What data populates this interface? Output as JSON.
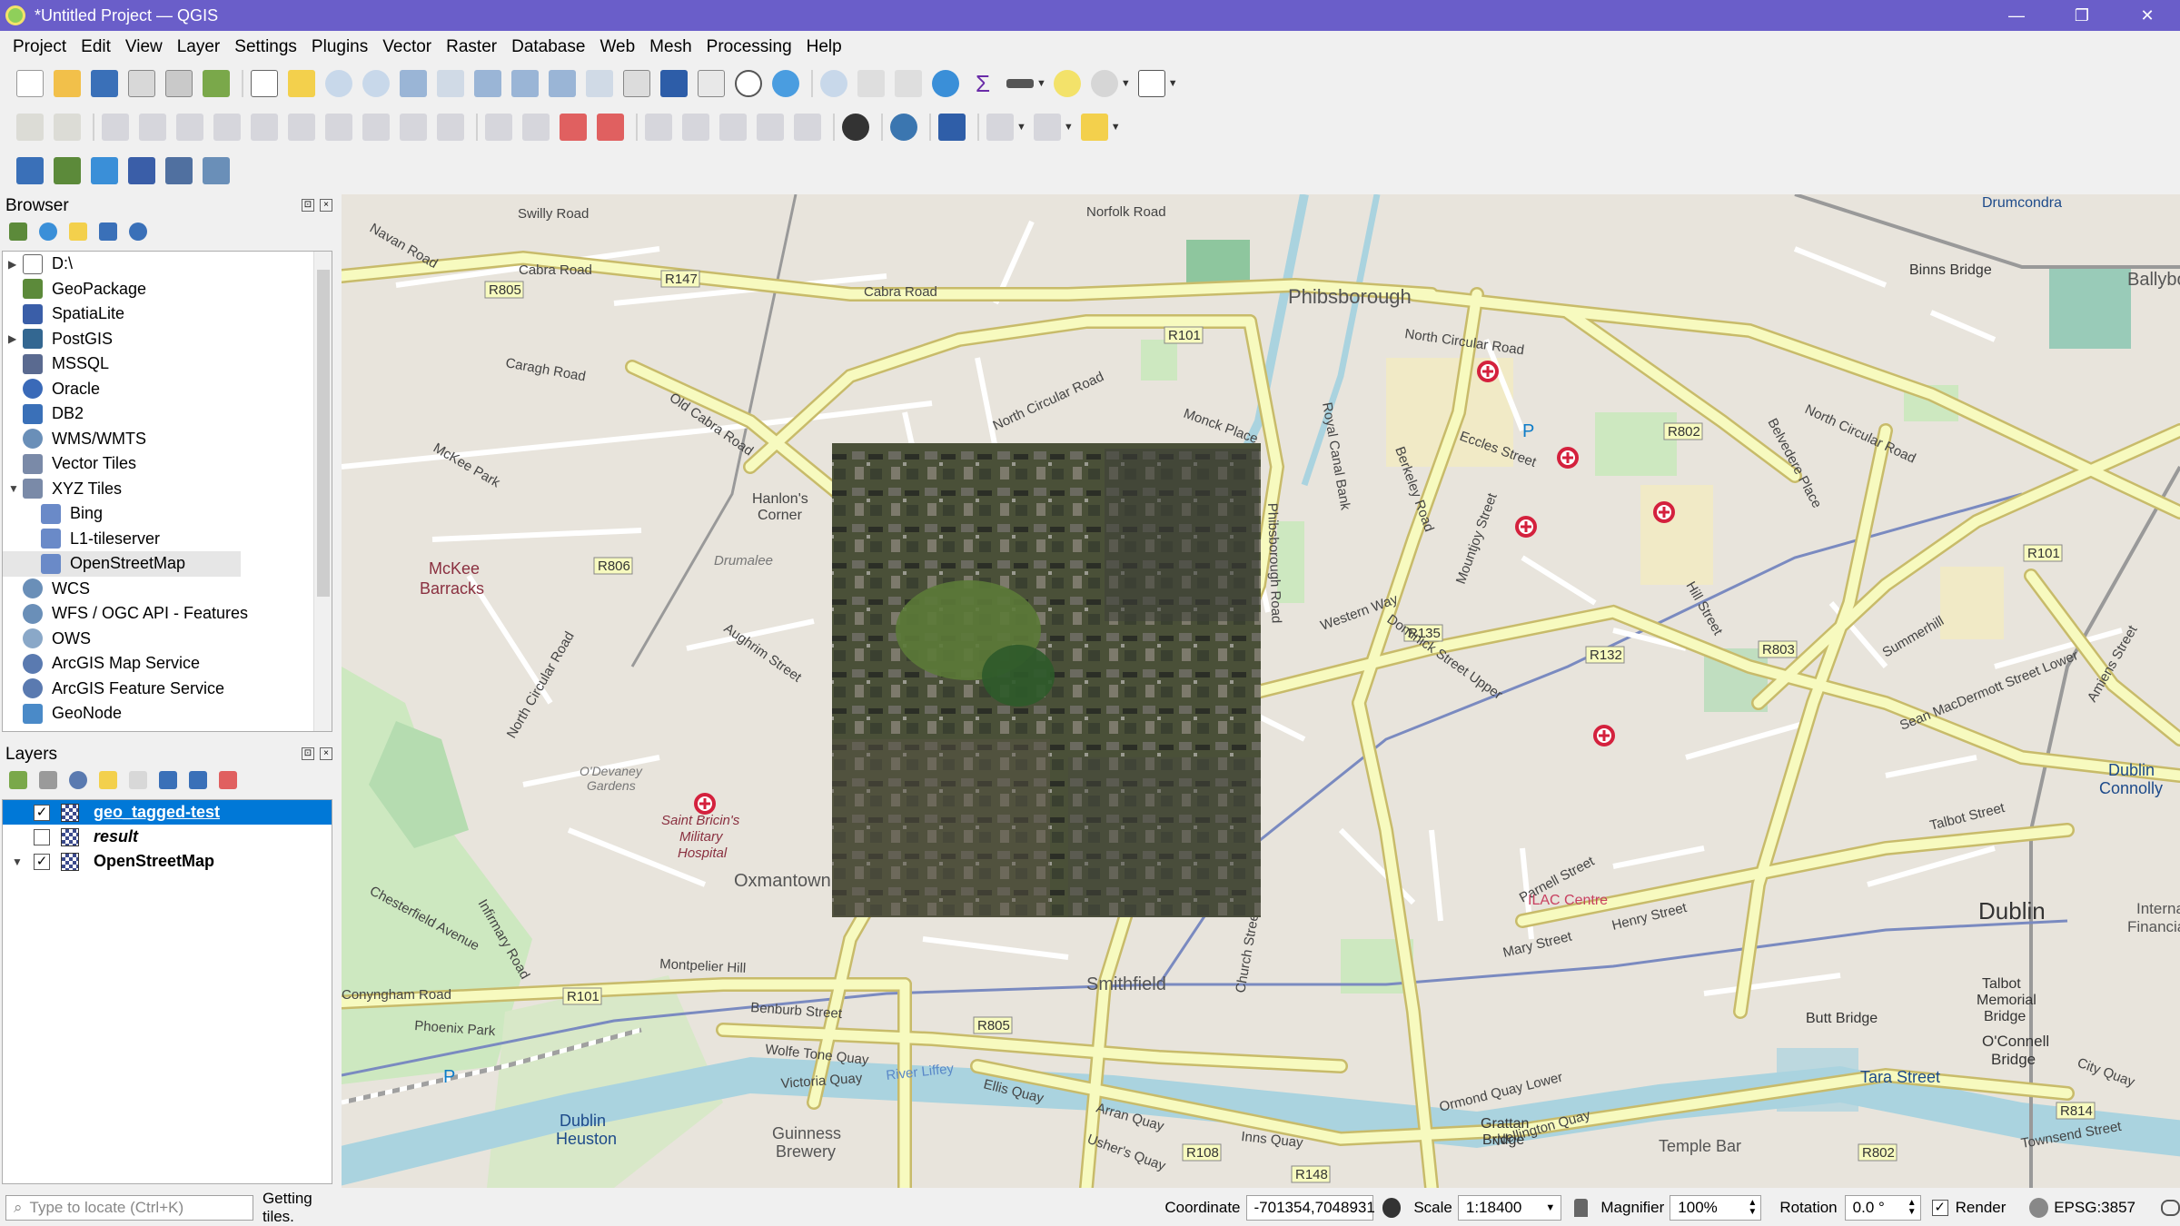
{
  "window": {
    "title": "*Untitled Project — QGIS",
    "minimize": "—",
    "restore": "❐",
    "close": "✕"
  },
  "menu": [
    "Project",
    "Edit",
    "View",
    "Layer",
    "Settings",
    "Plugins",
    "Vector",
    "Raster",
    "Database",
    "Web",
    "Mesh",
    "Processing",
    "Help"
  ],
  "browser": {
    "title": "Browser",
    "items": [
      {
        "label": "D:\\",
        "expand": "▶"
      },
      {
        "label": "GeoPackage",
        "expand": ""
      },
      {
        "label": "SpatiaLite",
        "expand": ""
      },
      {
        "label": "PostGIS",
        "expand": "▶"
      },
      {
        "label": "MSSQL",
        "expand": ""
      },
      {
        "label": "Oracle",
        "expand": ""
      },
      {
        "label": "DB2",
        "expand": ""
      },
      {
        "label": "WMS/WMTS",
        "expand": ""
      },
      {
        "label": "Vector Tiles",
        "expand": ""
      },
      {
        "label": "XYZ Tiles",
        "expand": "▼"
      },
      {
        "label": "Bing",
        "expand": ""
      },
      {
        "label": "L1-tileserver",
        "expand": ""
      },
      {
        "label": "OpenStreetMap",
        "expand": ""
      },
      {
        "label": "WCS",
        "expand": ""
      },
      {
        "label": "WFS / OGC API - Features",
        "expand": ""
      },
      {
        "label": "OWS",
        "expand": ""
      },
      {
        "label": "ArcGIS Map Service",
        "expand": ""
      },
      {
        "label": "ArcGIS Feature Service",
        "expand": ""
      },
      {
        "label": "GeoNode",
        "expand": ""
      }
    ]
  },
  "layers": {
    "title": "Layers",
    "items": [
      {
        "label": "geo_tagged-test",
        "checked": "✓"
      },
      {
        "label": "result",
        "checked": ""
      },
      {
        "label": "OpenStreetMap",
        "checked": "✓"
      }
    ]
  },
  "map": {
    "places": {
      "phibsborough": "Phibsborough",
      "dublin": "Dublin",
      "smithfield": "Smithfield",
      "mckee": "McKee",
      "barracks": "Barracks",
      "oxmantown": "Oxmantown",
      "hospital1": "Saint Bricin's",
      "hospital2": "Military",
      "hospital3": "Hospital",
      "dublin_heuston1": "Dublin",
      "dublin_heuston2": "Heuston",
      "ilac": "ILAC Centre",
      "tara": "Tara Street",
      "temple": "Temple Bar",
      "guinness1": "Guinness",
      "guinness2": "Brewery",
      "drumalee": "Drumalee",
      "odevaney1": "O'Devaney",
      "odevaney2": "Gardens",
      "hanlons1": "Hanlon's",
      "hanlons2": "Corner",
      "connolly1": "Dublin",
      "connolly2": "Connolly",
      "ballybough": "Ballybo",
      "internat1": "Interna",
      "internat2": "Financial",
      "oconnell1": "O'Connell",
      "oconnell2": "Bridge",
      "buttbridge": "Butt Bridge",
      "talbot1": "Talbot",
      "talbot2": "Memorial",
      "talbot3": "Bridge",
      "grattan1": "Grattan",
      "grattan2": "Bridge",
      "binns": "Binns Bridge",
      "drumcondra": "Drumcondra"
    },
    "streets": {
      "navan": "Navan Road",
      "cabra1": "Cabra Road",
      "cabra2": "Cabra Road",
      "ncr1": "North Circular Road",
      "ncr2": "North Circular Road",
      "ncr3": "North Circular Road",
      "ncr4": "North Circular Road",
      "oldcabra": "Old Cabra Road",
      "aughrim": "Aughrim Street",
      "conyngham": "Conyngham Road",
      "wolfetone": "Wolfe Tone Quay",
      "victoria": "Victoria Quay",
      "ellis": "Ellis Quay",
      "arran": "Arran Quay",
      "ushers": "Usher's Quay",
      "inns": "Inns Quay",
      "ormond": "Ormond Quay Lower",
      "wellington": "Wellington Quay",
      "parnell": "Parnell Street",
      "summerhill": "Summerhill",
      "westernway": "Western Way",
      "dominick": "Dominick Street Upper",
      "seanmac": "Sean MacDermott Street Lower",
      "infirmary": "Infirmary Road",
      "chesterfield": "Chesterfield Avenue",
      "phoenixpark": "Phoenix Park",
      "benburb": "Benburb Street",
      "church": "Church Street",
      "henry": "Henry Street",
      "mary": "Mary Street",
      "eccles": "Eccles Street",
      "berkeley": "Berkeley Road",
      "phibsboro_rd": "Phibsborough Road",
      "hill": "Hill Street",
      "belvedere": "Belvedere Place",
      "amiens": "Amiens Street",
      "talbot": "Talbot Street",
      "cityquay": "City Quay",
      "townsend": "Townsend Street",
      "montpelier": "Montpelier Hill",
      "monck": "Monck Place",
      "royalcanal": "Royal Canal Bank",
      "mountjoy": "Mountjoy Street",
      "riverliffey": "River Liffey",
      "norfolk": "Norfolk Road",
      "swilly": "Swilly Road",
      "mckeepark": "McKee Park",
      "caragh": "Caragh Road"
    },
    "roadrefs": [
      "R805",
      "R147",
      "R101",
      "R806",
      "R135",
      "R132",
      "R802",
      "R803",
      "R101",
      "R101",
      "R805",
      "R108",
      "R148",
      "R802",
      "R814"
    ],
    "parking": "P"
  },
  "status": {
    "locate_placeholder": "Type to locate (Ctrl+K)",
    "message": "Getting tiles.",
    "coordinate_label": "Coordinate",
    "coordinate": "-701354,7048931",
    "scale_label": "Scale",
    "scale": "1:18400",
    "magnifier_label": "Magnifier",
    "magnifier": "100%",
    "rotation_label": "Rotation",
    "rotation": "0.0 °",
    "render_label": "Render",
    "render_checked": "✓",
    "crs": "EPSG:3857"
  }
}
